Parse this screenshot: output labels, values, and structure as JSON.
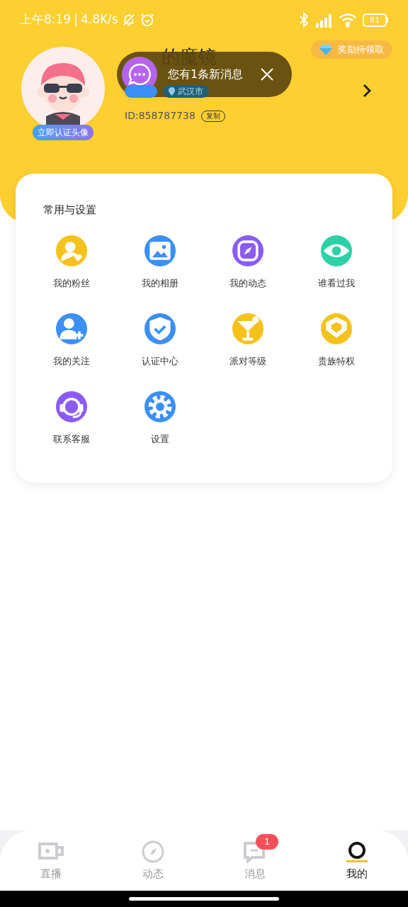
{
  "status_bar": {
    "time": "上午8:19",
    "separator": "|",
    "speed": "4.8K/s",
    "battery": "81"
  },
  "reward": {
    "label": "奖励待领取"
  },
  "profile": {
    "name": "的魔镜",
    "location": "武汉市",
    "id": "ID:858787738",
    "copy": "复制",
    "avatar_badge": "立即认证头像"
  },
  "toast": {
    "message": "您有1条新消息"
  },
  "section": {
    "title": "常用与设置",
    "items": [
      {
        "label": "我的粉丝",
        "kind": "fans",
        "color": "#f5c21b"
      },
      {
        "label": "我的相册",
        "kind": "album",
        "color": "#3b8ff5"
      },
      {
        "label": "我的动态",
        "kind": "moments",
        "color": "#8a5cf5"
      },
      {
        "label": "谁看过我",
        "kind": "visitors",
        "color": "#2dd1a6"
      },
      {
        "label": "我的关注",
        "kind": "follow",
        "color": "#3b8ff5"
      },
      {
        "label": "认证中心",
        "kind": "verify",
        "color": "#3b8ff5"
      },
      {
        "label": "派对等级",
        "kind": "party",
        "color": "#f5c21b"
      },
      {
        "label": "贵族特权",
        "kind": "noble",
        "color": "#f5c21b"
      },
      {
        "label": "联系客服",
        "kind": "service",
        "color": "#8a5cf5"
      },
      {
        "label": "设置",
        "kind": "settings",
        "color": "#3b8ff5"
      }
    ]
  },
  "tab_bar": [
    {
      "label": "直播",
      "kind": "live",
      "selected": false
    },
    {
      "label": "动态",
      "kind": "explore",
      "selected": false
    },
    {
      "label": "消息",
      "kind": "messages",
      "selected": false,
      "badge": "1"
    },
    {
      "label": "我的",
      "kind": "me",
      "selected": true
    }
  ]
}
